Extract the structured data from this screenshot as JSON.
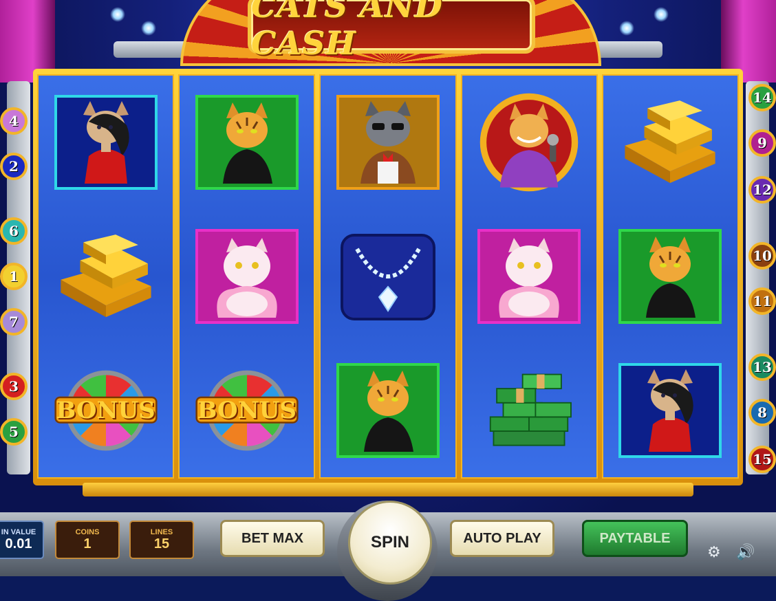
{
  "title": "CATS AND CASH",
  "reels": [
    [
      "lady-cat",
      "gold-bars",
      "bonus-wheel"
    ],
    [
      "tiger-cat",
      "white-persian-cat",
      "bonus-wheel"
    ],
    [
      "gray-cat-croupier",
      "diamond-necklace",
      "tiger-cat"
    ],
    [
      "host-cat-microphone",
      "white-persian-cat",
      "cash-stacks"
    ],
    [
      "gold-bars",
      "tiger-cat",
      "lady-cat"
    ]
  ],
  "bonus_label": "BONUS",
  "lines_left": [
    "4",
    "2",
    "6",
    "1",
    "7",
    "3",
    "5"
  ],
  "lines_right": [
    "14",
    "9",
    "12",
    "10",
    "11",
    "13",
    "8",
    "15"
  ],
  "controls": {
    "coin_value_label": "IN VALUE",
    "coin_value": "0.01",
    "coins_label": "COINS",
    "coins": "1",
    "lines_label": "LINES",
    "lines": "15",
    "bet_max": "BET MAX",
    "spin": "SPIN",
    "auto_play": "AUTO PLAY",
    "paytable": "PAYTABLE"
  },
  "icons": [
    "settings-icon",
    "sound-icon"
  ]
}
